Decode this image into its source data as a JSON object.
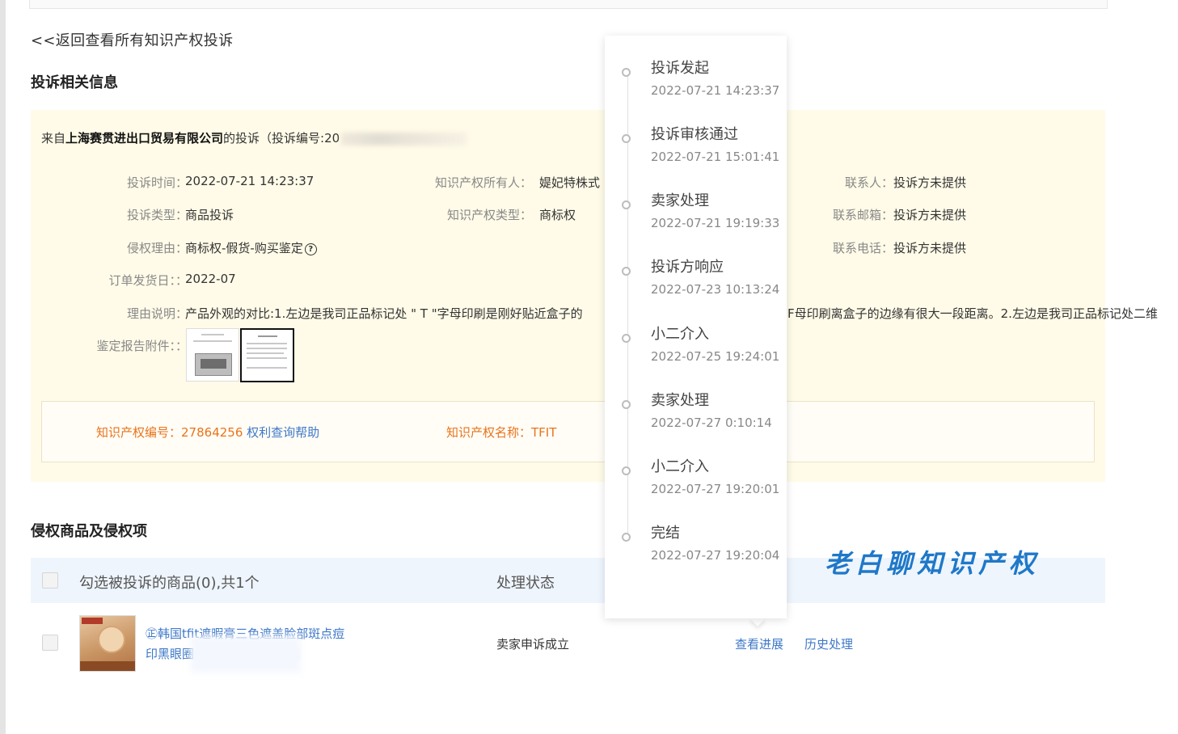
{
  "back_link": "<<返回查看所有知识产权投诉",
  "section1_title": "投诉相关信息",
  "complaint": {
    "from_prefix": "来自",
    "company": "上海赛贯进出口贸易有限公司",
    "from_suffix": "的投诉（投诉编号:20",
    "fields": {
      "time_label": "投诉时间：",
      "time_value": "2022-07-21 14:23:37",
      "type_label": "投诉类型：",
      "type_value": "商品投诉",
      "reason_label": "侵权理由：",
      "reason_value": "商标权-假货-购买鉴定",
      "ship_label": "订单发货日：：",
      "ship_value": "2022-07",
      "explain_label": "理由说明：",
      "explain_value_left": "产品外观的对比:1.左边是我司正品标记处 \" T \"字母印刷是刚好贴近盒子的",
      "explain_value_right": "F母印刷离盒子的边缘有很大一段距离。2.左边是我司正品标记处二维",
      "attach_label": "鉴定报告附件：：",
      "owner_label": "知识产权所有人：",
      "owner_value": "媞妃特株式",
      "iptype_label": "知识产权类型：",
      "iptype_value": "商标权",
      "contact_label": "联系人：",
      "contact_value": "投诉方未提供",
      "email_label": "联系邮箱：",
      "email_value": "投诉方未提供",
      "phone_label": "联系电话：",
      "phone_value": "投诉方未提供"
    },
    "ip_box": {
      "number_label": "知识产权编号：",
      "number_value": "27864256",
      "help_link": "权利查询帮助",
      "name_label": "知识产权名称：",
      "name_value": "TFIT"
    }
  },
  "section2_title": "侵权商品及侵权项",
  "table": {
    "select_header": "勾选被投诉的商品(0),共1个",
    "status_header": "处理状态",
    "rows": [
      {
        "product_line1": "㊣韩国tfit遮暇膏三色遮盖脸部斑点痘",
        "product_line2": "印黑眼圈",
        "status": "卖家申诉成立",
        "action_view": "查看进展",
        "action_history": "历史处理"
      }
    ]
  },
  "timeline": [
    {
      "title": "投诉发起",
      "time": "2022-07-21 14:23:37"
    },
    {
      "title": "投诉审核通过",
      "time": "2022-07-21 15:01:41"
    },
    {
      "title": "卖家处理",
      "time": "2022-07-21 19:19:33"
    },
    {
      "title": "投诉方响应",
      "time": "2022-07-23 10:13:24"
    },
    {
      "title": "小二介入",
      "time": "2022-07-25 19:24:01"
    },
    {
      "title": "卖家处理",
      "time": "2022-07-27 0:10:14"
    },
    {
      "title": "小二介入",
      "time": "2022-07-27 19:20:01"
    },
    {
      "title": "完结",
      "time": "2022-07-27 19:20:04"
    }
  ],
  "watermark": "老白聊知识产权",
  "colors": {
    "link": "#3e78c8",
    "orange": "#e8741b",
    "panel": "#fffbe8",
    "table_head": "#eef5fd"
  }
}
